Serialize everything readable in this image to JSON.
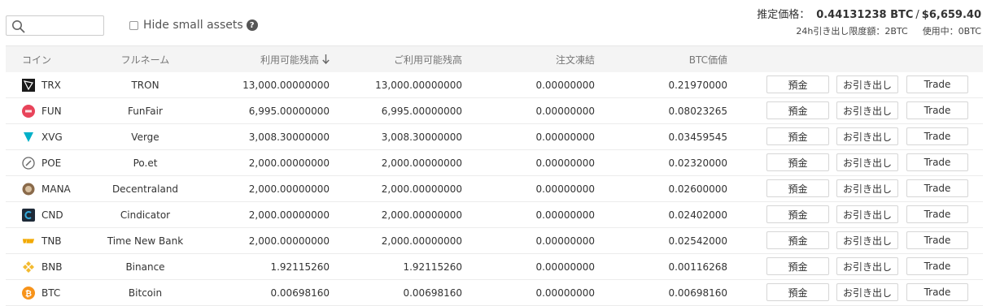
{
  "search": {
    "placeholder": ""
  },
  "hide_small": {
    "label": "Hide small assets",
    "help": "?"
  },
  "estimate": {
    "label": "推定価格：",
    "btc": "0.44131238 BTC",
    "sep": "/",
    "usd": "$6,659.40"
  },
  "limits": {
    "withdraw_limit": "24h引き出し限度額：2BTC",
    "in_use": "使用中：0BTC"
  },
  "table": {
    "headers": {
      "coin": "コイン",
      "name": "フルネーム",
      "balance": "利用可能残高",
      "available": "ご利用可能残高",
      "in_order": "注文凍結",
      "btc_value": "BTC価値"
    },
    "buttons": {
      "deposit": "預金",
      "withdraw": "お引き出し",
      "trade": "Trade"
    },
    "rows": [
      {
        "coin": "TRX",
        "name": "TRON",
        "balance": "13,000.00000000",
        "available": "13,000.00000000",
        "in_order": "0.00000000",
        "btc_value": "0.21970000",
        "icon": "tron-icon",
        "color": "#1a1a1a"
      },
      {
        "coin": "FUN",
        "name": "FunFair",
        "balance": "6,995.00000000",
        "available": "6,995.00000000",
        "in_order": "0.00000000",
        "btc_value": "0.08023265",
        "icon": "funfair-icon",
        "color": "#e8445a"
      },
      {
        "coin": "XVG",
        "name": "Verge",
        "balance": "3,008.30000000",
        "available": "3,008.30000000",
        "in_order": "0.00000000",
        "btc_value": "0.03459545",
        "icon": "verge-icon",
        "color": "#00b0c8"
      },
      {
        "coin": "POE",
        "name": "Po.et",
        "balance": "2,000.00000000",
        "available": "2,000.00000000",
        "in_order": "0.00000000",
        "btc_value": "0.02320000",
        "icon": "poet-icon",
        "color": "#666666"
      },
      {
        "coin": "MANA",
        "name": "Decentraland",
        "balance": "2,000.00000000",
        "available": "2,000.00000000",
        "in_order": "0.00000000",
        "btc_value": "0.02600000",
        "icon": "decentraland-icon",
        "color": "#8a6a4a"
      },
      {
        "coin": "CND",
        "name": "Cindicator",
        "balance": "2,000.00000000",
        "available": "2,000.00000000",
        "in_order": "0.00000000",
        "btc_value": "0.02402000",
        "icon": "cindicator-icon",
        "color": "#1e2a38"
      },
      {
        "coin": "TNB",
        "name": "Time New Bank",
        "balance": "2,000.00000000",
        "available": "2,000.00000000",
        "in_order": "0.00000000",
        "btc_value": "0.02542000",
        "icon": "timenewbank-icon",
        "color": "#f2a900"
      },
      {
        "coin": "BNB",
        "name": "Binance",
        "balance": "1.92115260",
        "available": "1.92115260",
        "in_order": "0.00000000",
        "btc_value": "0.00116268",
        "icon": "binance-icon",
        "color": "#f3ba2f"
      },
      {
        "coin": "BTC",
        "name": "Bitcoin",
        "balance": "0.00698160",
        "available": "0.00698160",
        "in_order": "0.00000000",
        "btc_value": "0.00698160",
        "icon": "bitcoin-icon",
        "color": "#f7931a"
      }
    ]
  }
}
